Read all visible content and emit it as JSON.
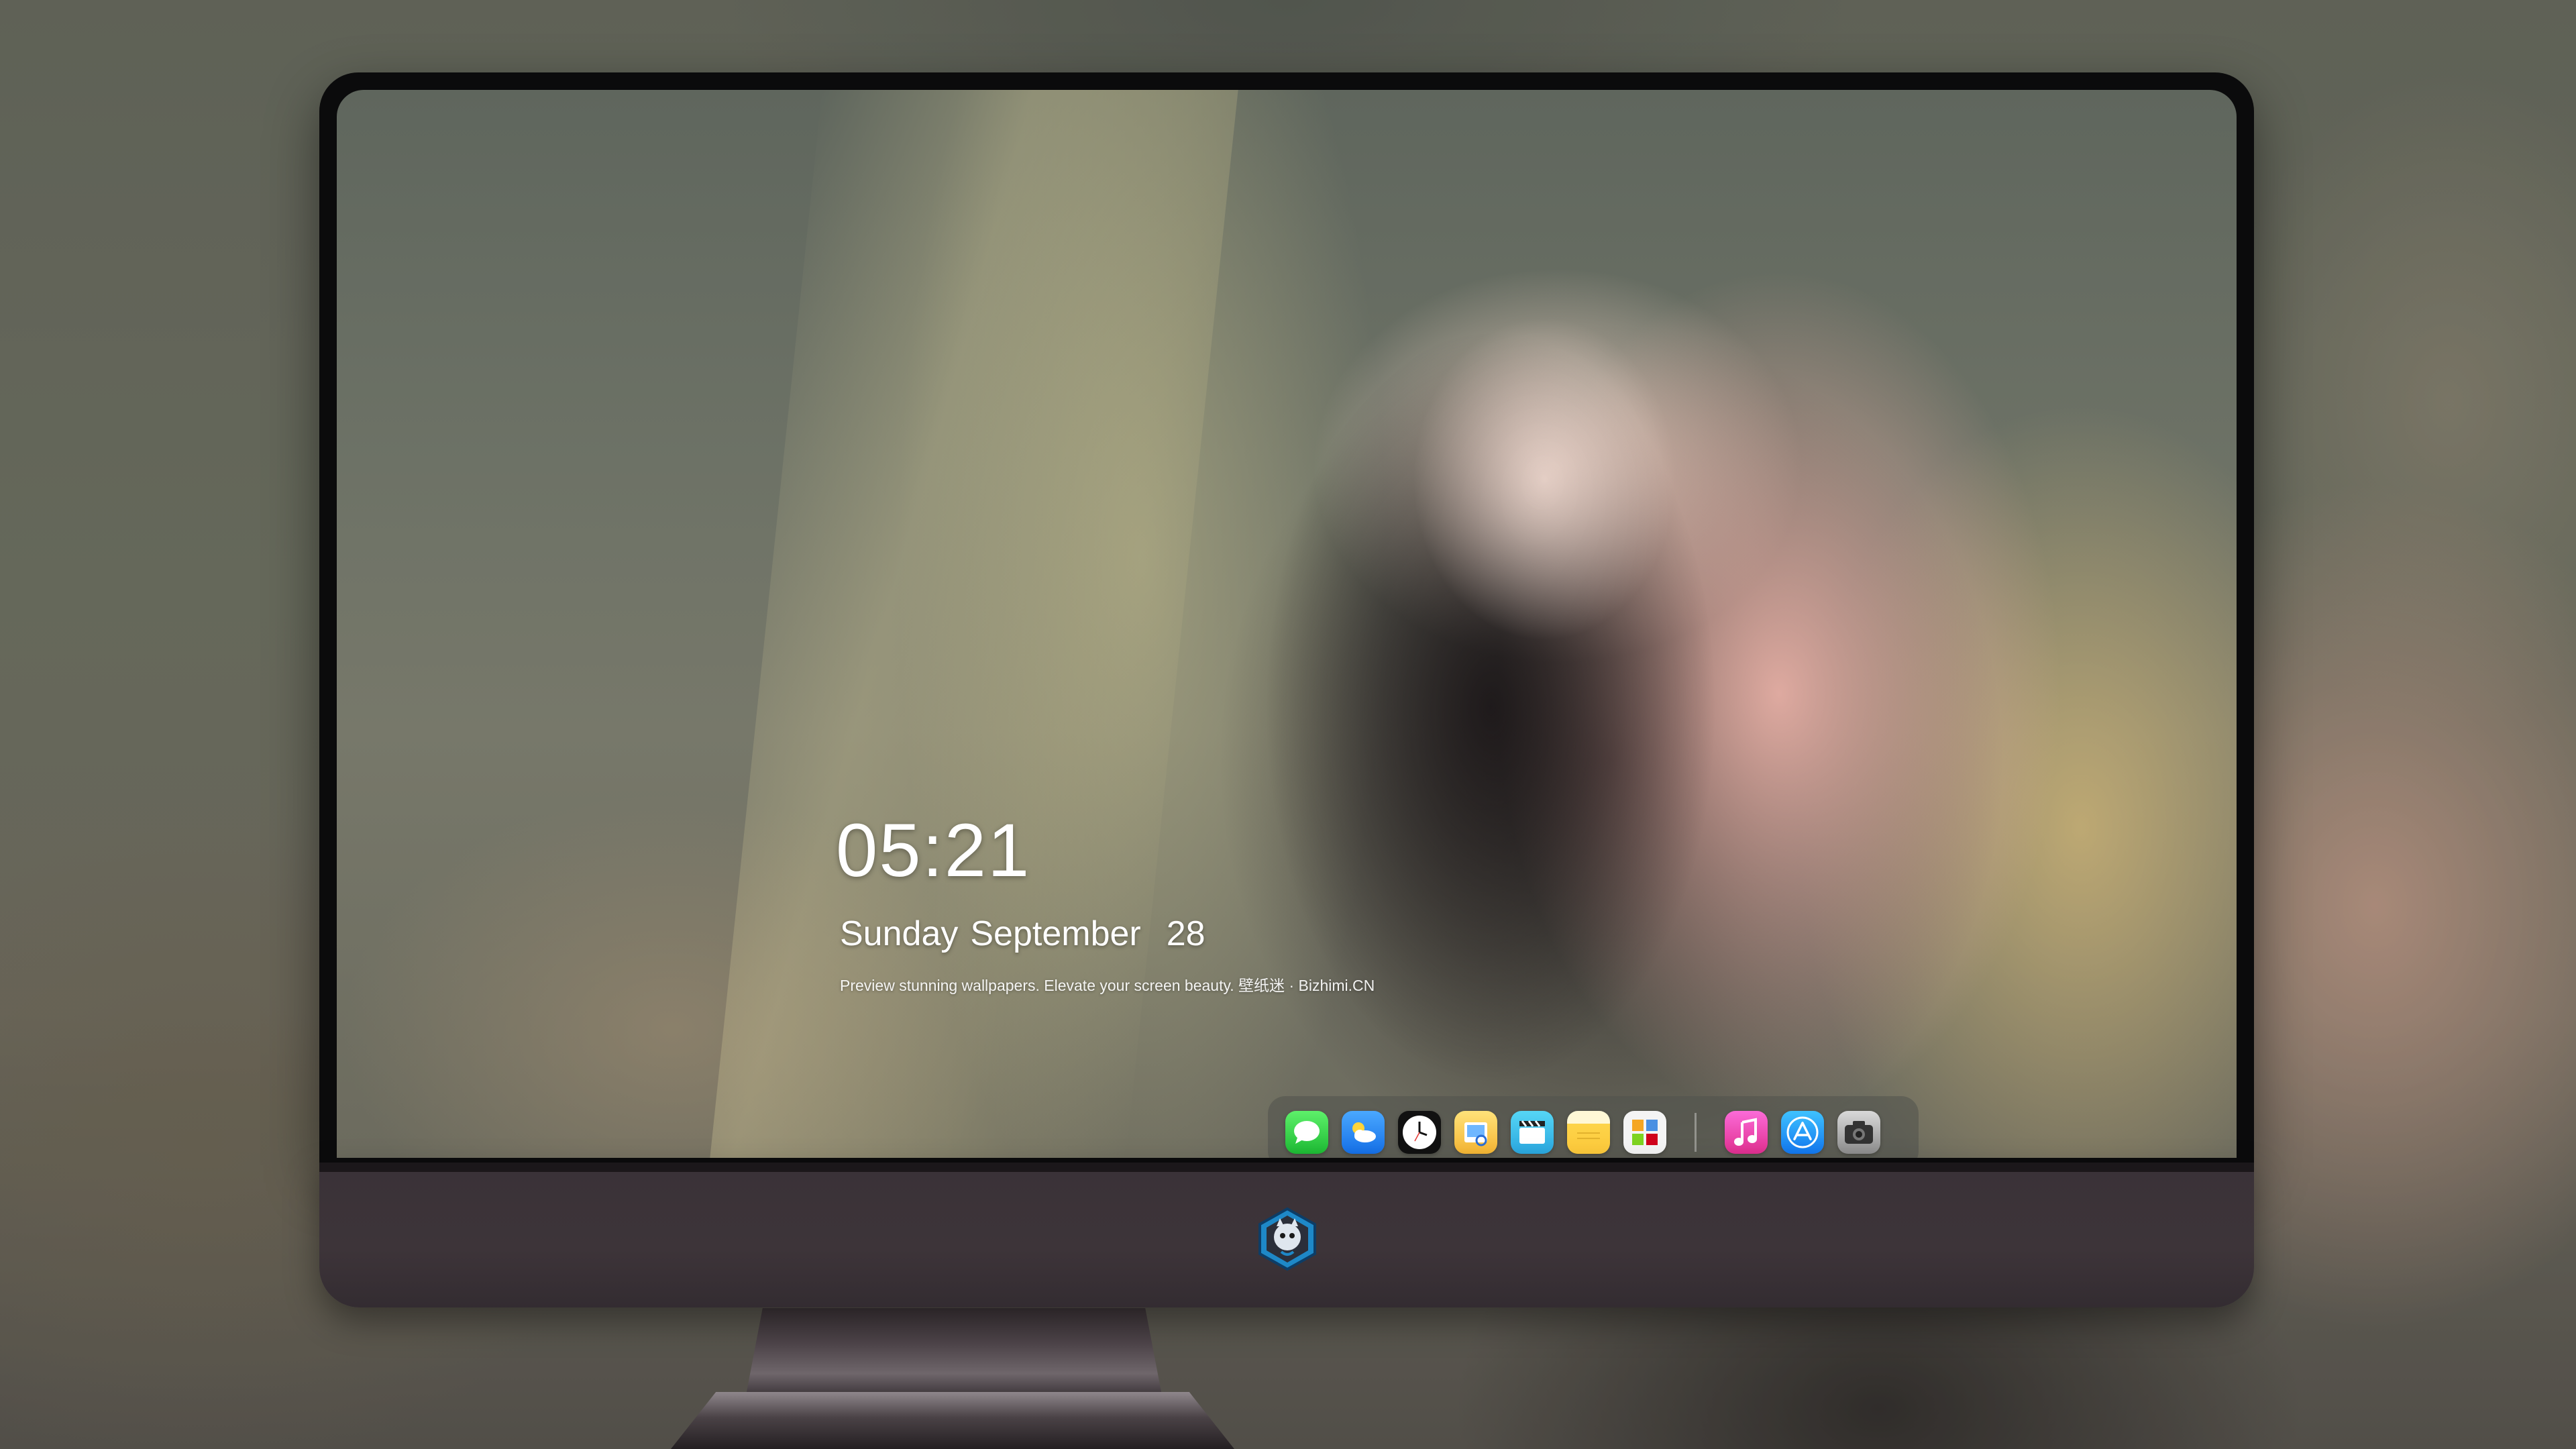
{
  "lock_screen": {
    "time": "05:21",
    "weekday": "Sunday",
    "month": "September",
    "day": "28",
    "tagline": "Preview stunning wallpapers. Elevate your screen beauty. 壁纸迷 · Bizhimi.CN"
  },
  "dock": {
    "apps": [
      {
        "icon": "messages-icon",
        "color": "#2fd14a"
      },
      {
        "icon": "weather-icon",
        "color": "#2a86f5"
      },
      {
        "icon": "clock-icon",
        "color": "#111111"
      },
      {
        "icon": "preview-icon",
        "color": "#f5c03f"
      },
      {
        "icon": "clips-icon",
        "color": "#3bbde9"
      },
      {
        "icon": "notes-icon",
        "color": "#fdd44a"
      },
      {
        "icon": "photos-icon",
        "color": "#f4f4f4"
      },
      {
        "icon": "music-icon",
        "color": "#f04db5"
      },
      {
        "icon": "app-store-icon",
        "color": "#1f8df3"
      },
      {
        "icon": "camera-icon",
        "color": "#a8a8a8"
      }
    ]
  },
  "monitor": {
    "logo": "dragon-mascot-logo"
  },
  "colors": {
    "bezel": "#0b0b0c",
    "chin": "#3a3238",
    "clock_text": "#ffffff"
  }
}
